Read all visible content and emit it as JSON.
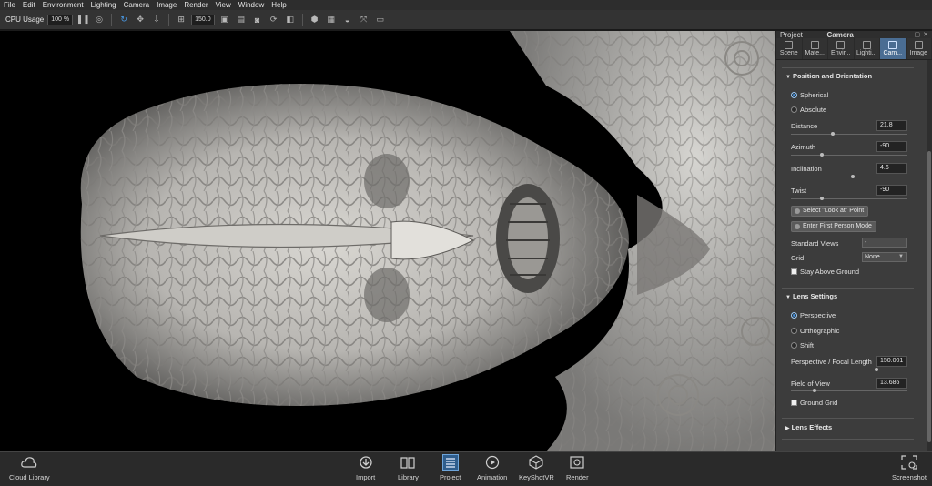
{
  "menu": [
    "File",
    "Edit",
    "Environment",
    "Lighting",
    "Camera",
    "Image",
    "Render",
    "View",
    "Window",
    "Help"
  ],
  "toolbar": {
    "cpu_label": "CPU Usage",
    "cpu_value": "100 %",
    "zoom_value": "150.0"
  },
  "panel": {
    "header_left": "Project",
    "header_title": "Camera",
    "tabs": [
      {
        "label": "Scene",
        "icon": "scene-icon"
      },
      {
        "label": "Mate...",
        "icon": "material-icon"
      },
      {
        "label": "Envir...",
        "icon": "environment-icon"
      },
      {
        "label": "Lighti...",
        "icon": "lighting-icon"
      },
      {
        "label": "Cam...",
        "icon": "camera-icon",
        "active": true
      },
      {
        "label": "Image",
        "icon": "image-icon"
      }
    ],
    "position": {
      "title": "Position and Orientation",
      "spherical": "Spherical",
      "absolute": "Absolute",
      "distance_label": "Distance",
      "distance_value": "21.8",
      "azimuth_label": "Azimuth",
      "azimuth_value": "-90",
      "inclination_label": "Inclination",
      "inclination_value": "4.6",
      "twist_label": "Twist",
      "twist_value": "-90",
      "look_at_button": "Select \"Look at\" Point",
      "first_person_button": "Enter First Person Mode",
      "standard_views_label": "Standard Views",
      "standard_views_value": "-",
      "grid_label": "Grid",
      "grid_value": "None",
      "stay_above_ground": "Stay Above Ground"
    },
    "lens": {
      "title": "Lens Settings",
      "perspective": "Perspective",
      "orthographic": "Orthographic",
      "shift": "Shift",
      "focal_label": "Perspective / Focal Length",
      "focal_value": "150.001",
      "fov_label": "Field of View",
      "fov_value": "13.686",
      "ground_grid": "Ground Grid"
    },
    "lens_effects": {
      "title": "Lens Effects"
    }
  },
  "bottom": {
    "cloud_library": "Cloud Library",
    "import": "Import",
    "library": "Library",
    "project": "Project",
    "animation": "Animation",
    "keyshotvr": "KeyShotVR",
    "render": "Render",
    "screenshot": "Screenshot"
  }
}
